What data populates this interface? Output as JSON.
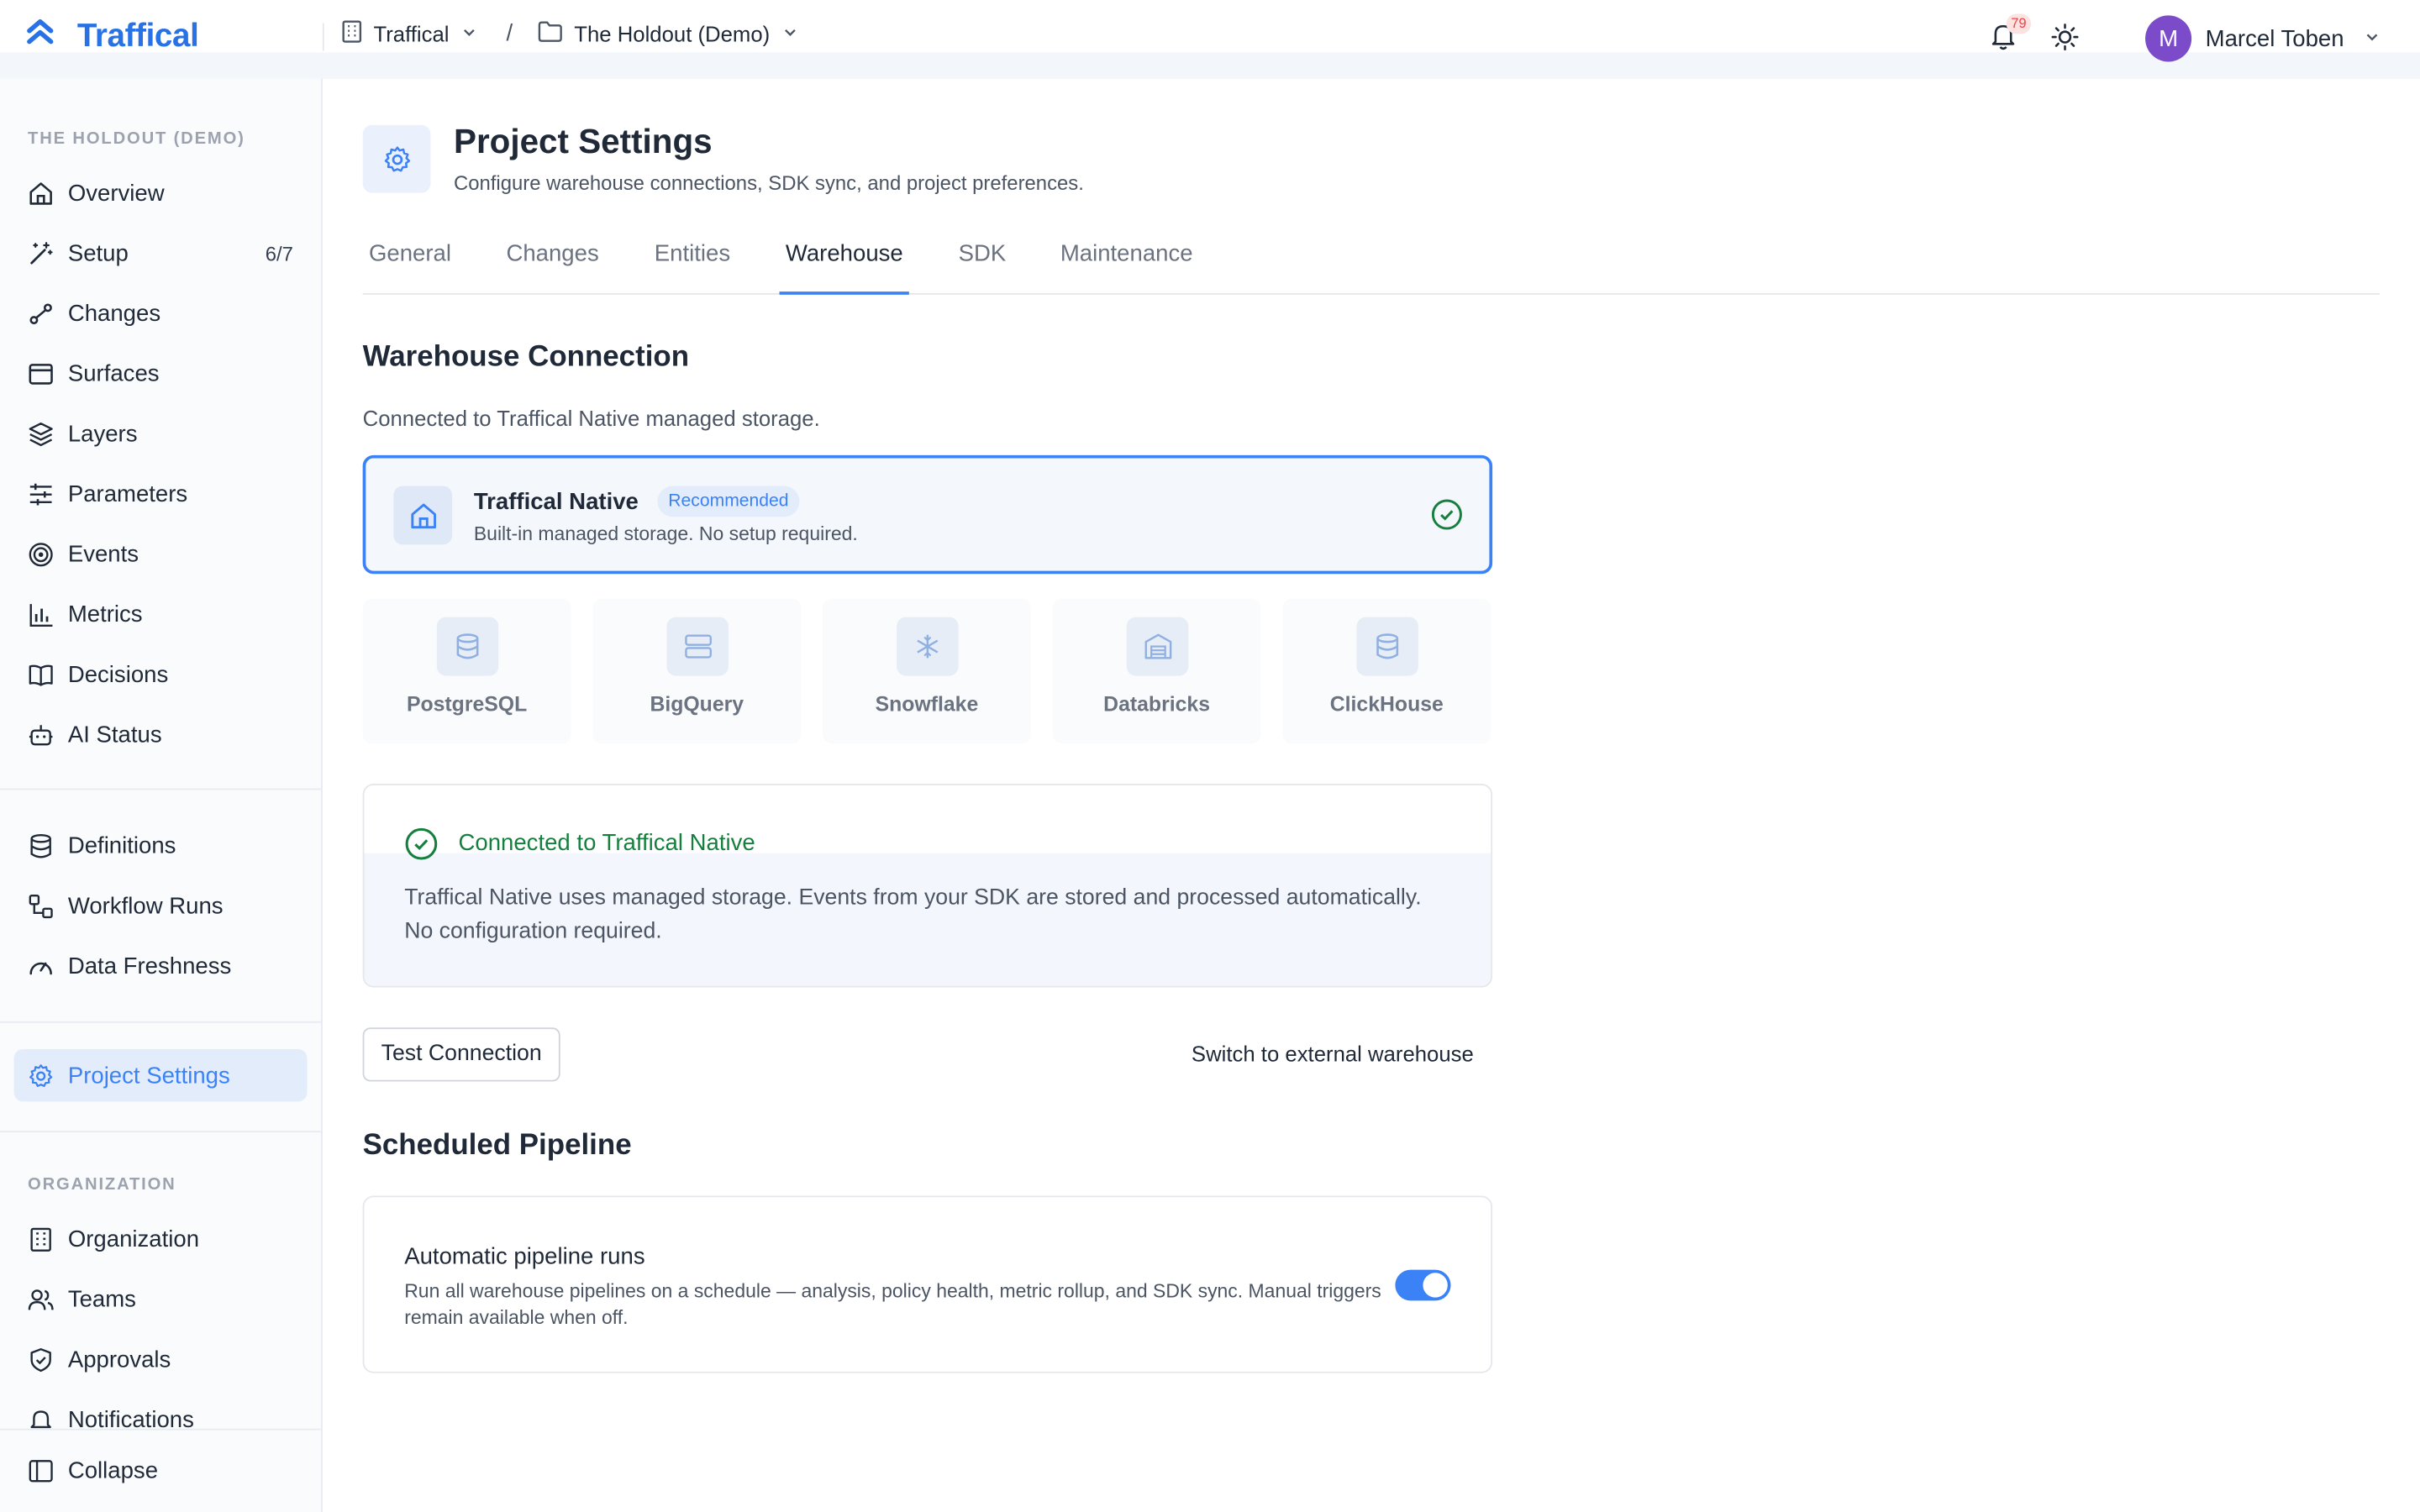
{
  "topbar": {
    "brand": "Traffical",
    "workspace": "Traffical",
    "separator": "/",
    "project": "The Holdout (Demo)",
    "notification_count": "79",
    "user_initial": "M",
    "user_name": "Marcel Toben"
  },
  "sidebar": {
    "project_heading": "THE HOLDOUT (DEMO)",
    "items": [
      {
        "label": "Overview",
        "icon": "home-icon"
      },
      {
        "label": "Setup",
        "icon": "wand-icon",
        "count": "6/7"
      },
      {
        "label": "Changes",
        "icon": "changes-icon"
      },
      {
        "label": "Surfaces",
        "icon": "window-icon"
      },
      {
        "label": "Layers",
        "icon": "layers-icon"
      },
      {
        "label": "Parameters",
        "icon": "sliders-icon"
      },
      {
        "label": "Events",
        "icon": "target-icon"
      },
      {
        "label": "Metrics",
        "icon": "bar-chart-icon"
      },
      {
        "label": "Decisions",
        "icon": "book-icon"
      },
      {
        "label": "AI Status",
        "icon": "bot-icon"
      }
    ],
    "data_items": [
      {
        "label": "Definitions",
        "icon": "database-icon"
      },
      {
        "label": "Workflow Runs",
        "icon": "workflow-icon"
      },
      {
        "label": "Data Freshness",
        "icon": "gauge-icon"
      }
    ],
    "settings_item": {
      "label": "Project Settings",
      "icon": "gear-icon"
    },
    "org_heading": "ORGANIZATION",
    "org_items": [
      {
        "label": "Organization",
        "icon": "building-icon"
      },
      {
        "label": "Teams",
        "icon": "users-icon"
      },
      {
        "label": "Approvals",
        "icon": "shield-check-icon"
      },
      {
        "label": "Notifications",
        "icon": "bell-icon"
      }
    ],
    "collapse_label": "Collapse"
  },
  "page": {
    "title": "Project Settings",
    "subtitle": "Configure warehouse connections, SDK sync, and project preferences.",
    "tabs": [
      "General",
      "Changes",
      "Entities",
      "Warehouse",
      "SDK",
      "Maintenance"
    ],
    "active_tab": "Warehouse"
  },
  "warehouse": {
    "section_title": "Warehouse Connection",
    "description": "Connected to Traffical Native managed storage.",
    "native": {
      "name": "Traffical Native",
      "badge": "Recommended",
      "description": "Built-in managed storage. No setup required.",
      "selected": true
    },
    "options": [
      {
        "label": "PostgreSQL",
        "icon": "database-icon"
      },
      {
        "label": "BigQuery",
        "icon": "server-icon"
      },
      {
        "label": "Snowflake",
        "icon": "snowflake-icon"
      },
      {
        "label": "Databricks",
        "icon": "warehouse-icon"
      },
      {
        "label": "ClickHouse",
        "icon": "database-icon"
      }
    ],
    "status_title": "Connected to Traffical Native",
    "status_text": "Traffical Native uses managed storage. Events from your SDK are stored and processed automatically. No configuration required.",
    "test_button": "Test Connection",
    "switch_button": "Switch to external warehouse"
  },
  "pipeline": {
    "section_title": "Scheduled Pipeline",
    "title": "Automatic pipeline runs",
    "description": "Run all warehouse pipelines on a schedule — analysis, policy health, metric rollup, and SDK sync. Manual triggers remain available when off.",
    "enabled": true
  },
  "colors": {
    "accent": "#3b82f6",
    "brand": "#2872e6",
    "success": "#15803d",
    "avatar": "#7c4bc9"
  }
}
